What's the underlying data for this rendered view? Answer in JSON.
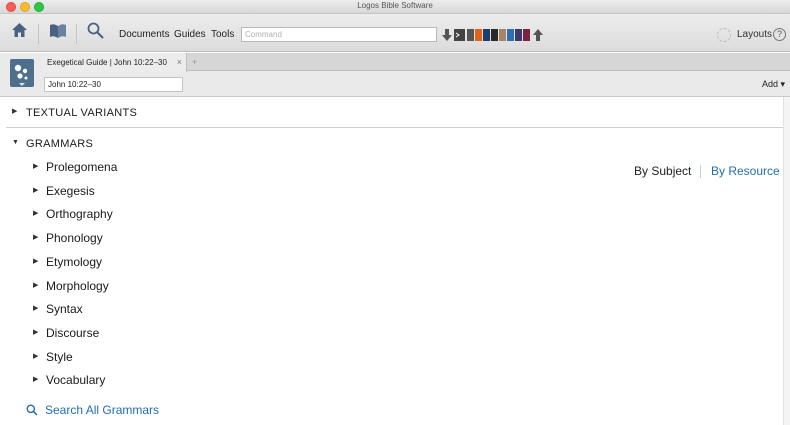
{
  "window": {
    "title": "Logos Bible Software"
  },
  "toolbar": {
    "menu": [
      "Documents",
      "Guides",
      "Tools"
    ],
    "command_placeholder": "Command",
    "books": [
      {
        "color": "#555555"
      },
      {
        "color": "#e2641c"
      },
      {
        "color": "#1d3e6b"
      },
      {
        "color": "#2a2a2a"
      },
      {
        "color": "#a98462"
      },
      {
        "color": "#2d6fb3"
      },
      {
        "color": "#3a3a6e"
      },
      {
        "color": "#7b2343"
      }
    ],
    "layouts_label": "Layouts",
    "help_label": "?"
  },
  "panel": {
    "tab_title": "Exegetical Guide | John 10:22–30",
    "tab_close": "×",
    "tab_add": "+",
    "reference": "John 10:22–30",
    "add_label": "Add ▾"
  },
  "content": {
    "textual_variants": "TEXTUAL VARIANTS",
    "grammars": "GRAMMARS",
    "view": {
      "by_subject": "By Subject",
      "by_resource": "By Resource"
    },
    "grammar_items": [
      "Prolegomena",
      "Exegesis",
      "Orthography",
      "Phonology",
      "Etymology",
      "Morphology",
      "Syntax",
      "Discourse",
      "Style",
      "Vocabulary"
    ],
    "search_all": "Search All Grammars"
  },
  "colors": {
    "link": "#1f6fb2",
    "panel_logo": "#4e6f8e"
  }
}
